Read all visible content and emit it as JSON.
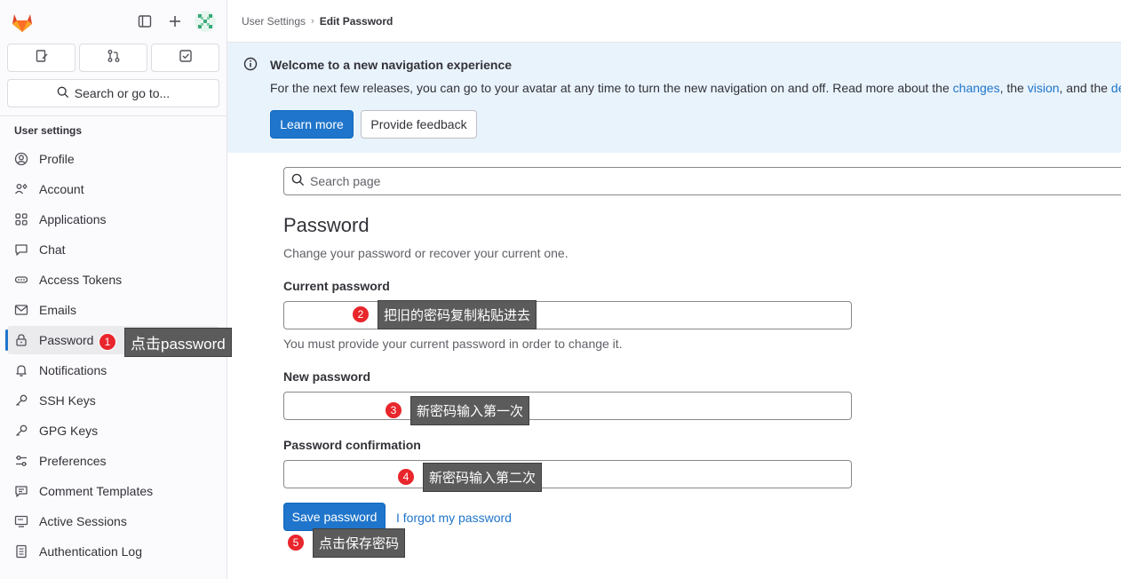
{
  "sidebar": {
    "section_title": "User settings",
    "search_label": "Search or go to...",
    "items": [
      {
        "label": "Profile",
        "icon": "profile-icon"
      },
      {
        "label": "Account",
        "icon": "account-icon"
      },
      {
        "label": "Applications",
        "icon": "applications-icon"
      },
      {
        "label": "Chat",
        "icon": "chat-icon"
      },
      {
        "label": "Access Tokens",
        "icon": "token-icon"
      },
      {
        "label": "Emails",
        "icon": "mail-icon"
      },
      {
        "label": "Password",
        "icon": "lock-icon",
        "active": true
      },
      {
        "label": "Notifications",
        "icon": "bell-icon"
      },
      {
        "label": "SSH Keys",
        "icon": "key-icon"
      },
      {
        "label": "GPG Keys",
        "icon": "key-icon"
      },
      {
        "label": "Preferences",
        "icon": "preferences-icon"
      },
      {
        "label": "Comment Templates",
        "icon": "comment-icon"
      },
      {
        "label": "Active Sessions",
        "icon": "monitor-icon"
      },
      {
        "label": "Authentication Log",
        "icon": "log-icon"
      }
    ]
  },
  "breadcrumb": {
    "parent": "User Settings",
    "current": "Edit Password"
  },
  "alert": {
    "title": "Welcome to a new navigation experience",
    "body_prefix": "For the next few releases, you can go to your avatar at any time to turn the new navigation on and off. Read more about the ",
    "link_changes": "changes",
    "sep1": ", the ",
    "link_vision": "vision",
    "sep2": ", and the ",
    "link_design": "de",
    "learn_more": "Learn more",
    "provide_feedback": "Provide feedback"
  },
  "main": {
    "search_placeholder": "Search page",
    "title": "Password",
    "description": "Change your password or recover your current one.",
    "current_label": "Current password",
    "current_help": "You must provide your current password in order to change it.",
    "new_label": "New password",
    "confirm_label": "Password confirmation",
    "save_button": "Save password",
    "forgot_link": "I forgot my password"
  },
  "annotations": [
    {
      "number": "1",
      "text": "点击password"
    },
    {
      "number": "2",
      "text": "把旧的密码复制粘贴进去"
    },
    {
      "number": "3",
      "text": "新密码输入第一次"
    },
    {
      "number": "4",
      "text": "新密码输入第二次"
    },
    {
      "number": "5",
      "text": "点击保存密码"
    }
  ],
  "colors": {
    "brand": "#e24329",
    "accent": "#1f75cb",
    "alert_bg": "#e9f3fc",
    "badge": "#e8262c",
    "tooltip": "#5b5b5b"
  }
}
